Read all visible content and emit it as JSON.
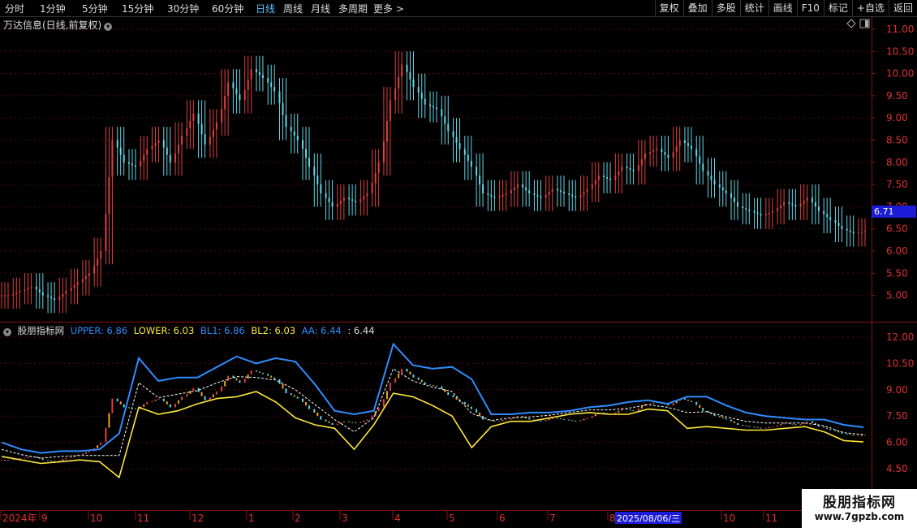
{
  "toolbar": {
    "tabs": [
      "分时",
      "1分钟",
      "5分钟",
      "15分钟",
      "30分钟",
      "60分钟",
      "日线",
      "周线",
      "月线",
      "多周期",
      "更多 >"
    ],
    "active_tab": "日线",
    "right_buttons": [
      "复权",
      "叠加",
      "多股",
      "统计",
      "画线",
      "F10",
      "标记",
      "+自选",
      "返回"
    ]
  },
  "main_chart": {
    "title": "万达信息(日线,前复权)",
    "price_axis": [
      "11.00",
      "10.50",
      "10.00",
      "9.50",
      "9.00",
      "8.50",
      "8.00",
      "7.50",
      "7.00",
      "6.50",
      "6.00",
      "5.50",
      "5.00"
    ],
    "current_price": "6.71"
  },
  "indicator": {
    "name": "股朋指标网",
    "items": [
      {
        "label": "UPPER: 6.86",
        "color": "#2f8cff"
      },
      {
        "label": "LOWER: 6.03",
        "color": "#ffe83a"
      },
      {
        "label": "BL1: 6.86",
        "color": "#2f8cff"
      },
      {
        "label": "BL2: 6.03",
        "color": "#ffe83a"
      },
      {
        "label": "AA: 6.44",
        "color": "#2f8cff"
      },
      {
        "label": ": 6.44",
        "color": "#dddddd"
      }
    ],
    "axis": [
      "12.00",
      "10.50",
      "9.00",
      "7.50",
      "6.00",
      "4.50"
    ]
  },
  "date_axis": {
    "labels": [
      "2024年",
      "9",
      "10",
      "11",
      "12",
      "1",
      "2",
      "3",
      "4",
      "5",
      "6",
      "7",
      "8",
      "10",
      "11"
    ],
    "cursor_date": "2025/08/06/三"
  },
  "watermark": {
    "line1": "股朋指标网",
    "line2": "www.7gpzb.com"
  },
  "chart_data": {
    "type": "candlestick",
    "title": "万达信息(日线,前复权)",
    "y_range_price": [
      4.5,
      11.2
    ],
    "y_range_indicator": [
      3.5,
      12.5
    ],
    "close_series": [
      5.0,
      5.1,
      5.2,
      5.0,
      4.9,
      5.1,
      5.3,
      5.5,
      6.0,
      8.5,
      8.0,
      7.9,
      8.3,
      8.5,
      8.0,
      8.6,
      9.1,
      8.4,
      8.9,
      9.8,
      9.4,
      10.1,
      9.9,
      9.6,
      8.8,
      8.5,
      7.9,
      7.3,
      7.0,
      7.2,
      7.1,
      7.3,
      8.0,
      9.4,
      10.2,
      9.7,
      9.3,
      9.2,
      8.7,
      8.3,
      7.9,
      7.3,
      7.2,
      7.3,
      7.5,
      7.3,
      7.2,
      7.4,
      7.3,
      7.2,
      7.4,
      7.7,
      7.6,
      7.9,
      7.8,
      8.2,
      8.3,
      8.1,
      8.5,
      8.3,
      7.8,
      7.5,
      7.3,
      7.0,
      6.9,
      6.8,
      6.9,
      7.1,
      7.0,
      7.2,
      6.9,
      6.7,
      6.5,
      6.4,
      6.44
    ],
    "upper_series": [
      6.0,
      5.6,
      5.4,
      5.5,
      5.5,
      5.6,
      6.5,
      10.8,
      9.5,
      9.7,
      9.7,
      10.3,
      10.9,
      10.5,
      10.8,
      10.6,
      9.3,
      7.8,
      7.6,
      7.8,
      11.6,
      10.4,
      10.2,
      10.3,
      9.6,
      7.6,
      7.6,
      7.7,
      7.7,
      7.8,
      8.0,
      8.1,
      8.3,
      8.4,
      8.2,
      8.6,
      8.6,
      8.1,
      7.7,
      7.5,
      7.4,
      7.3,
      7.3,
      7.0,
      6.86
    ],
    "lower_series": [
      5.2,
      5.0,
      4.8,
      4.9,
      5.0,
      4.9,
      4.0,
      8.0,
      7.6,
      7.8,
      8.2,
      8.5,
      8.6,
      8.9,
      8.3,
      7.4,
      7.0,
      6.8,
      5.6,
      7.0,
      8.8,
      8.6,
      8.1,
      7.5,
      5.7,
      6.9,
      7.2,
      7.2,
      7.4,
      7.6,
      7.7,
      7.6,
      7.6,
      7.9,
      7.8,
      6.8,
      6.9,
      6.8,
      6.7,
      6.7,
      6.8,
      6.9,
      6.6,
      6.1,
      6.03
    ]
  }
}
